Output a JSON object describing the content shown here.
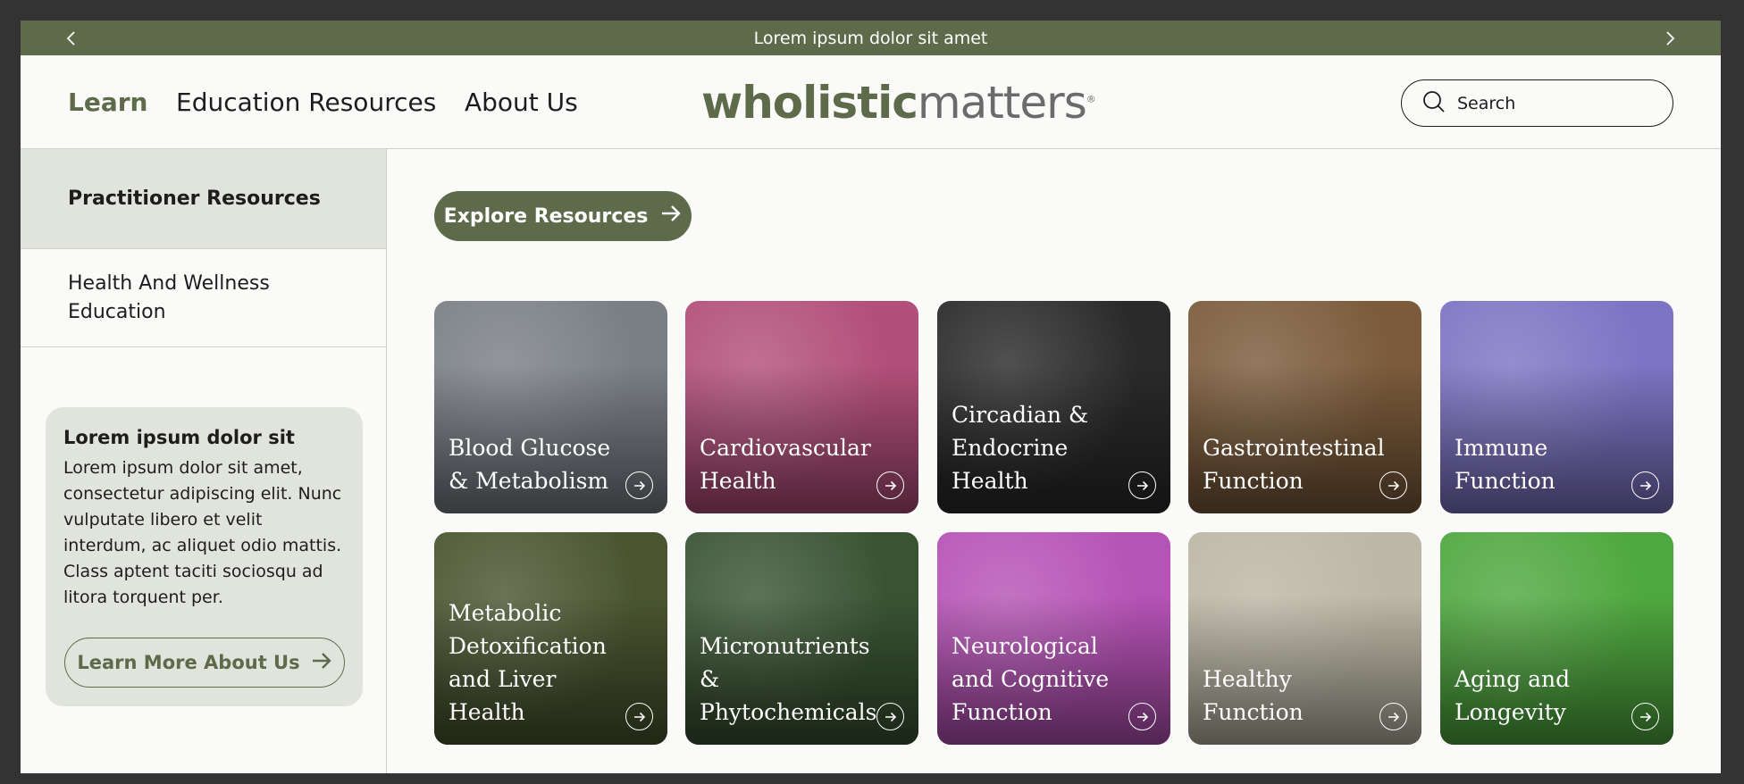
{
  "announcement": {
    "text": "Lorem ipsum dolor sit amet"
  },
  "nav": {
    "learn": "Learn",
    "education": "Education Resources",
    "about": "About Us"
  },
  "logo": {
    "bold": "wholistic",
    "light": "matters",
    "reg": "®"
  },
  "search": {
    "placeholder": "Search"
  },
  "sidebar": {
    "items": [
      {
        "label": "Practitioner Resources"
      },
      {
        "label": "Health And Wellness Education"
      }
    ]
  },
  "promo": {
    "title": "Lorem ipsum dolor sit",
    "body": "Lorem ipsum dolor sit amet, consectetur adipiscing elit. Nunc vulputate libero et velit interdum, ac aliquet odio mattis. Class aptent taciti sociosqu ad litora torquent per.",
    "button": "Learn More About Us"
  },
  "main": {
    "explore": "Explore Resources"
  },
  "categories": [
    {
      "label": "Blood Glucose & Metabolism",
      "color": "#7a7f86"
    },
    {
      "label": "Cardiovascular Health",
      "color": "#b24f7a"
    },
    {
      "label": "Circadian & Endocrine Health",
      "color": "#2a2a2a"
    },
    {
      "label": "Gastrointestinal Function",
      "color": "#7b5b3b"
    },
    {
      "label": "Immune Function",
      "color": "#7e74c4"
    },
    {
      "label": "Metabolic Detoxification and Liver Health",
      "color": "#4a5530"
    },
    {
      "label": "Micronutrients & Phytochemicals",
      "color": "#3a5433"
    },
    {
      "label": "Neurological and Cognitive Function",
      "color": "#b653b6"
    },
    {
      "label": "Healthy Function",
      "color": "#bcb7a6"
    },
    {
      "label": "Aging and Longevity",
      "color": "#4fa83f"
    }
  ],
  "theme": {
    "accent": "#5d6b4a",
    "sidebar_active": "#e1e4dc",
    "frame": "#333333"
  }
}
